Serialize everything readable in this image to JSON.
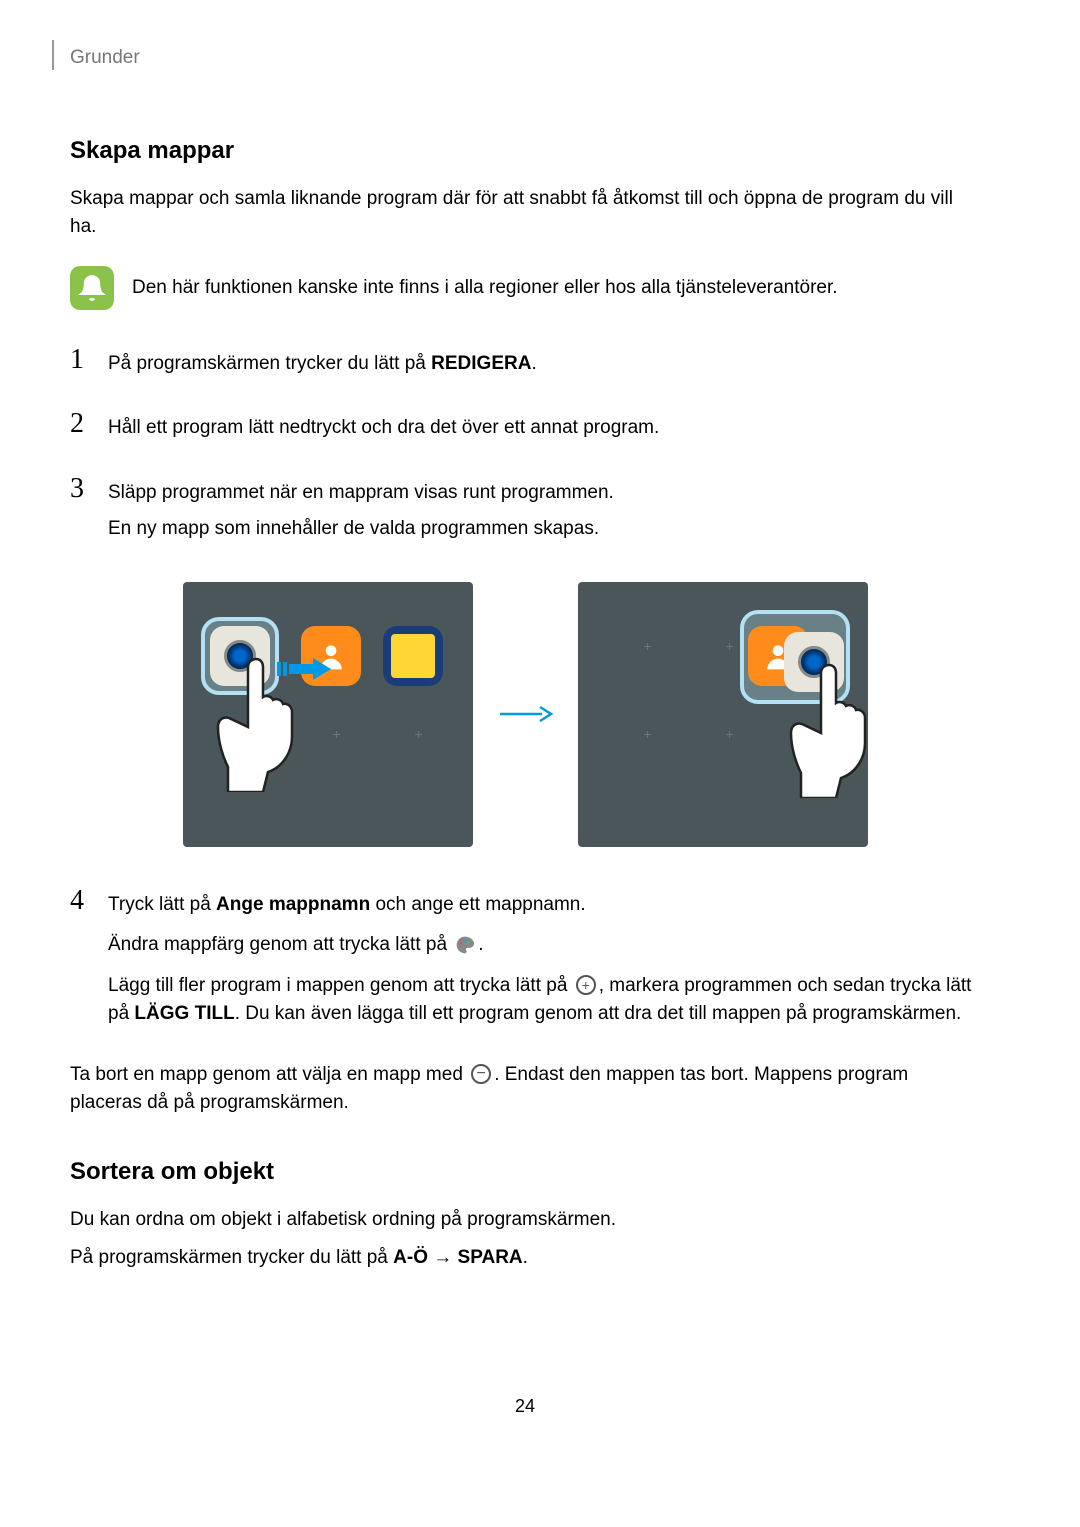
{
  "header": {
    "section": "Grunder"
  },
  "h1": "Skapa mappar",
  "intro": "Skapa mappar och samla liknande program där för att snabbt få åtkomst till och öppna de program du vill ha.",
  "note": "Den här funktionen kanske inte finns i alla regioner eller hos alla tjänsteleverantörer.",
  "steps": {
    "s1": {
      "num": "1",
      "pre": "På programskärmen trycker du lätt på ",
      "bold": "REDIGERA",
      "post": "."
    },
    "s2": {
      "num": "2",
      "text": "Håll ett program lätt nedtryckt och dra det över ett annat program."
    },
    "s3": {
      "num": "3",
      "line1": "Släpp programmet när en mappram visas runt programmen.",
      "line2": "En ny mapp som innehåller de valda programmen skapas."
    },
    "s4": {
      "num": "4",
      "line1_pre": "Tryck lätt på ",
      "line1_bold": "Ange mappnamn",
      "line1_post": " och ange ett mappnamn.",
      "line2_pre": "Ändra mappfärg genom att trycka lätt på ",
      "line2_post": ".",
      "line3_pre": "Lägg till fler program i mappen genom att trycka lätt på ",
      "line3_mid": ", markera programmen och sedan trycka lätt på ",
      "line3_bold": "LÄGG TILL",
      "line3_post": ". Du kan även lägga till ett program genom att dra det till mappen på programskärmen."
    }
  },
  "remove": {
    "pre": "Ta bort en mapp genom att välja en mapp med ",
    "post": ". Endast den mappen tas bort. Mappens program placeras då på programskärmen."
  },
  "sort": {
    "heading": "Sortera om objekt",
    "line1": "Du kan ordna om objekt i alfabetisk ordning på programskärmen.",
    "line2_pre": "På programskärmen trycker du lätt på ",
    "line2_b1": "A-Ö",
    "line2_arrow": " → ",
    "line2_b2": "SPARA",
    "line2_post": "."
  },
  "page": "24"
}
